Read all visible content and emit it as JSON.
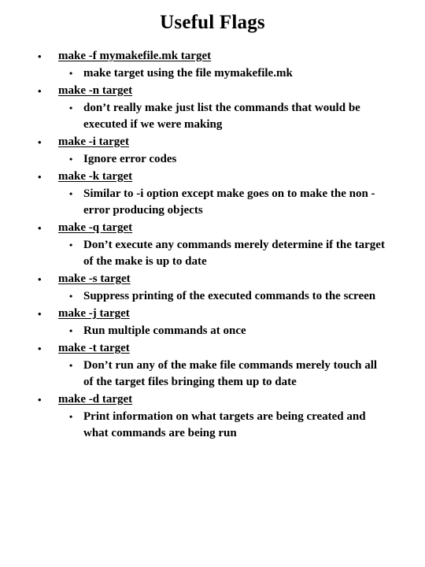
{
  "slide": {
    "title": "Useful Flags",
    "bullet_glyph_level1": "•",
    "bullet_glyph_level2": "•",
    "text_color": "#000000",
    "background_color": "#ffffff",
    "items": [
      {
        "flag": "make -f mymakefile.mk target",
        "description": "make target using the file mymakefile.mk"
      },
      {
        "flag": "make -n target",
        "description": "don’t really make just list the commands that would be executed if we were making"
      },
      {
        "flag": "make -i target",
        "description": "Ignore error codes"
      },
      {
        "flag": "make -k target",
        "description": "Similar to -i option except make goes on to make the non -error producing objects"
      },
      {
        "flag": "make -q target",
        "description": "Don’t execute any commands merely determine if the target of the make is up to date"
      },
      {
        "flag": "make -s target",
        "description": "Suppress printing of the executed commands to the screen"
      },
      {
        "flag": "make -j target",
        "description": "Run multiple commands at once"
      },
      {
        "flag": "make -t target",
        "description": "Don’t run any of the make file commands merely touch all of the target files bringing them up to date"
      },
      {
        "flag": "make -d target",
        "description": "Print information on what targets are being created and what commands are being run"
      }
    ]
  }
}
